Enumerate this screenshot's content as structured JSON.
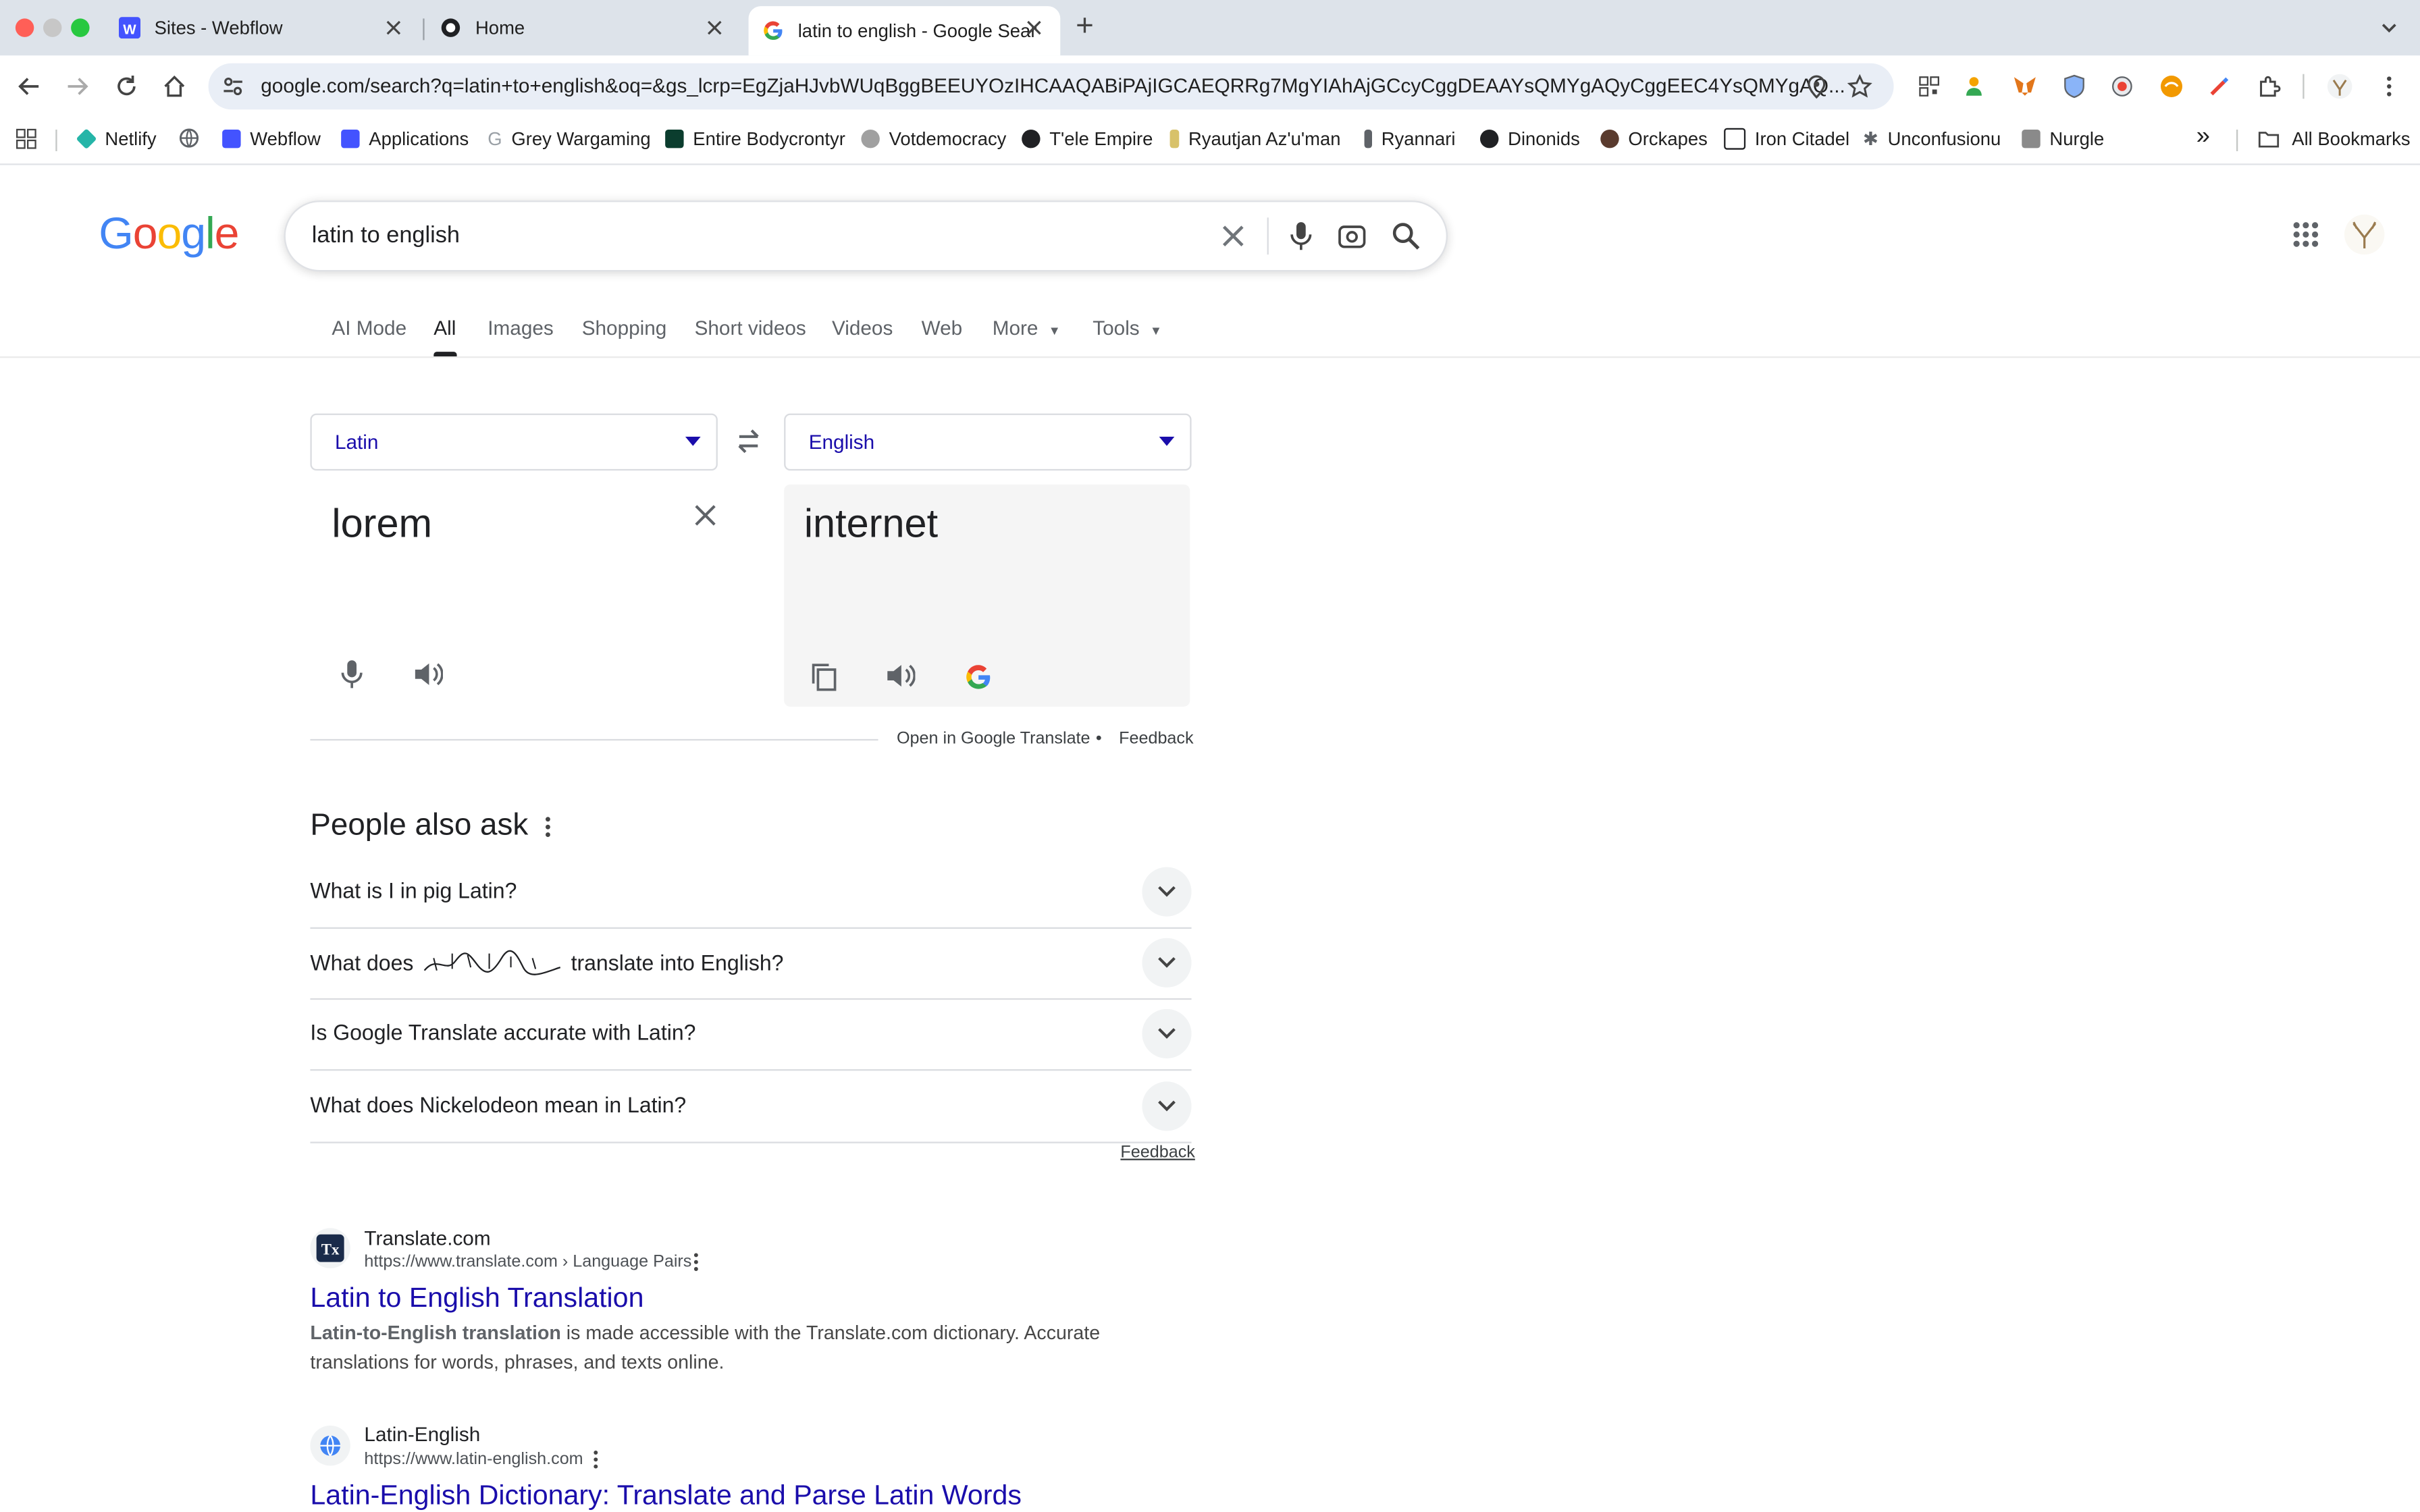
{
  "browser": {
    "tabs": [
      {
        "title": "Sites - Webflow",
        "active": false
      },
      {
        "title": "Home",
        "active": false
      },
      {
        "title": "latin to english - Google Sear",
        "active": true
      }
    ],
    "new_tab_symbol": "+",
    "url": "google.com/search?q=latin+to+english&oq=&gs_lcrp=EgZjaHJvbWUqBggBEEUYOzIHCAAQABiPAjIGCAEQRRg7MgYIAhAjGCcyCggDEAAYsQMYgAQyCggEEC4YsQMYgAQ..."
  },
  "bookmarks": [
    {
      "label": "Netlify",
      "color": "#25b5a8"
    },
    {
      "label": "",
      "color": "#5f6368"
    },
    {
      "label": "Webflow",
      "color": "#4353ff"
    },
    {
      "label": "Applications",
      "color": "#4353ff"
    },
    {
      "label": "Grey Wargaming",
      "color": "#9aa0a6"
    },
    {
      "label": "Entire Bodycrontyr",
      "color": "#0b3d2e"
    },
    {
      "label": "Votdemocracy",
      "color": "#6b6b6b"
    },
    {
      "label": "T'ele Empire",
      "color": "#202124"
    },
    {
      "label": "Ryautjan Az'u'man",
      "color": "#d8c26a"
    },
    {
      "label": "Ryannari",
      "color": "#5f6368"
    },
    {
      "label": "Dinonids",
      "color": "#202124"
    },
    {
      "label": "Orckapes",
      "color": "#5a3b2e"
    },
    {
      "label": "Iron Citadel",
      "color": "#202124"
    },
    {
      "label": "Unconfusionu",
      "color": "#5f6368"
    },
    {
      "label": "Nurgle",
      "color": "#8a8a8a"
    }
  ],
  "bookmarks_overflow": "»",
  "all_bookmarks": "All Bookmarks",
  "google": {
    "logo": [
      "G",
      "o",
      "o",
      "g",
      "l",
      "e"
    ],
    "logo_colors": [
      "#4285f4",
      "#ea4335",
      "#fbbc05",
      "#4285f4",
      "#34a853",
      "#ea4335"
    ],
    "query": "latin to english",
    "nav": [
      "AI Mode",
      "All",
      "Images",
      "Shopping",
      "Short videos",
      "Videos",
      "Web",
      "More",
      "Tools"
    ],
    "active_nav": "All"
  },
  "translate": {
    "source_lang": "Latin",
    "target_lang": "English",
    "source_text": "lorem",
    "target_text": "internet",
    "open_link": "Open in Google Translate",
    "separator": "•",
    "feedback": "Feedback"
  },
  "paa": {
    "title": "People also ask",
    "questions": [
      "What is I in pig Latin?",
      "What does",
      "Is Google Translate accurate with Latin?",
      "What does Nickelodeon mean in Latin?"
    ],
    "question2_suffix": "translate into English?",
    "feedback": "Feedback"
  },
  "results": [
    {
      "site": "Translate.com",
      "url": "https://www.translate.com › Language Pairs",
      "title": "Latin to English Translation",
      "snippet_bold": "Latin-to-English translation",
      "snippet": " is made accessible with the Translate.com dictionary. Accurate translations for words, phrases, and texts online."
    },
    {
      "site": "Latin-English",
      "url": "https://www.latin-english.com",
      "title": "Latin-English Dictionary: Translate and Parse Latin Words"
    }
  ]
}
